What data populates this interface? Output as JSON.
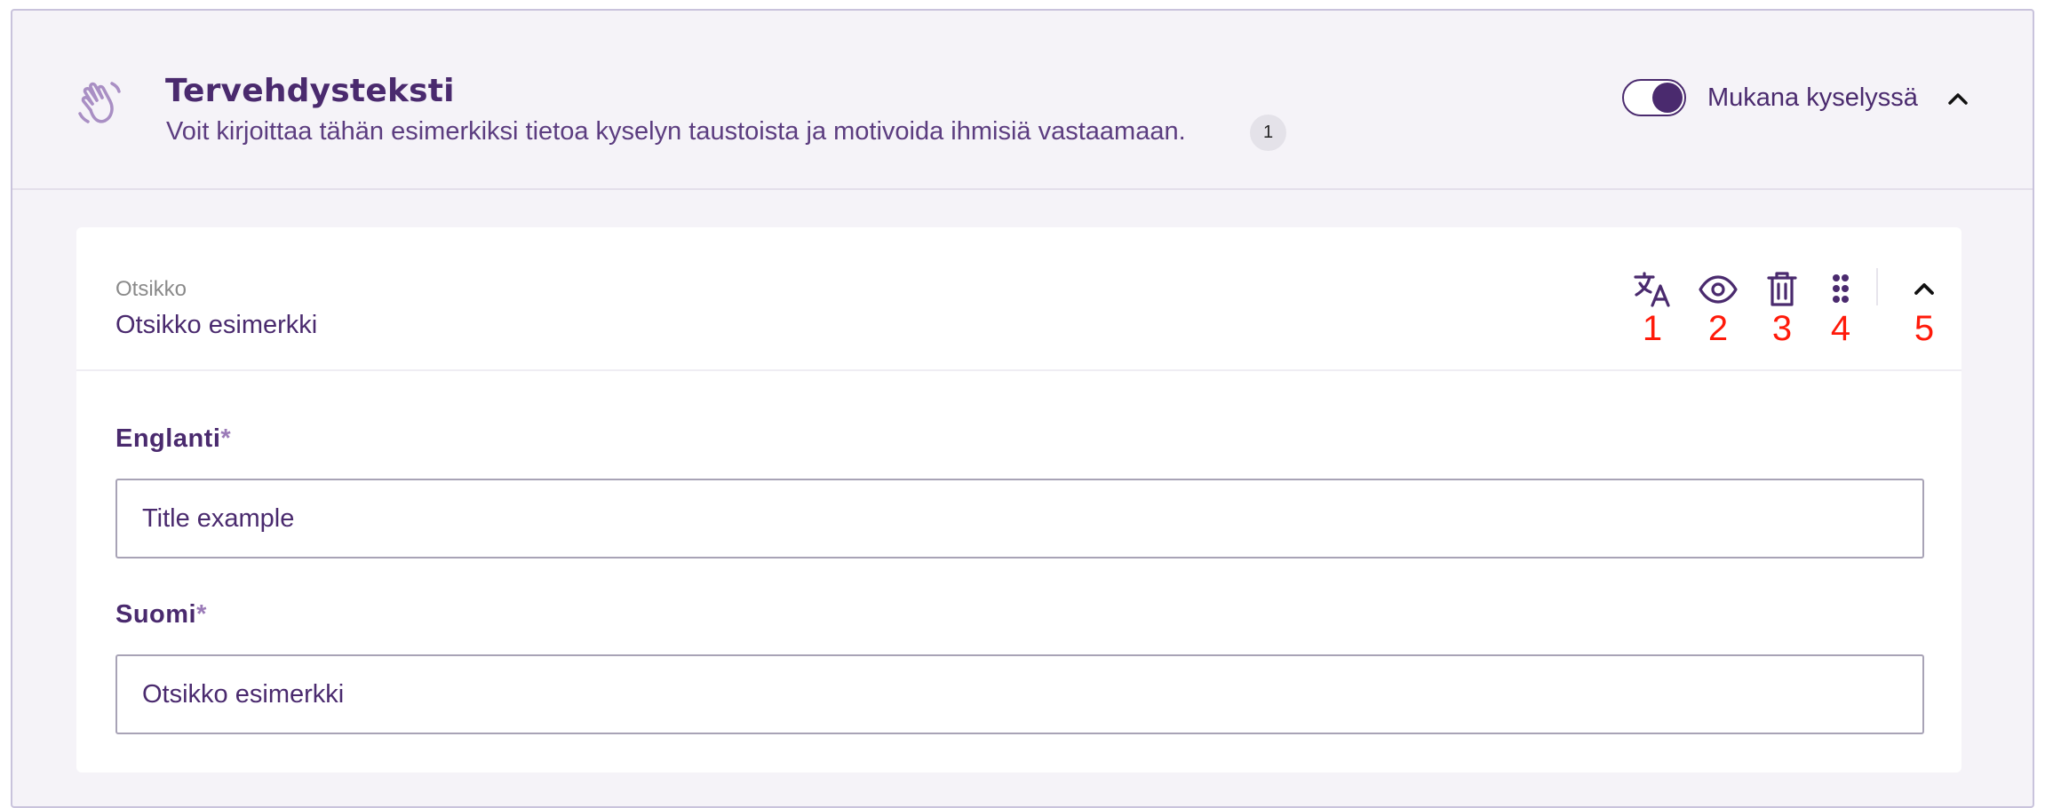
{
  "section": {
    "icon": "waving-hand-icon",
    "title": "Tervehdysteksti",
    "description": "Voit kirjoittaa tähän esimerkiksi tietoa kyselyn taustoista ja motivoida ihmisiä vastaamaan.",
    "count": "1",
    "toggle_label": "Mukana kyselyssä",
    "toggle_on": true
  },
  "card": {
    "sublabel": "Otsikko",
    "title": "Otsikko esimerkki",
    "toolbar": [
      {
        "icon": "translate-icon",
        "number": "1"
      },
      {
        "icon": "eye-icon",
        "number": "2"
      },
      {
        "icon": "trash-icon",
        "number": "3"
      },
      {
        "icon": "drag-handle-icon",
        "number": "4"
      },
      {
        "icon": "chevron-up-icon",
        "number": "5"
      }
    ],
    "fields": [
      {
        "label": "Englanti",
        "required_mark": "*",
        "value": "Title example"
      },
      {
        "label": "Suomi",
        "required_mark": "*",
        "value": "Otsikko esimerkki"
      }
    ]
  },
  "colors": {
    "brand": "#4a2a6e",
    "panel_bg": "#f5f3f8",
    "annotation": "#ff1a0a"
  }
}
